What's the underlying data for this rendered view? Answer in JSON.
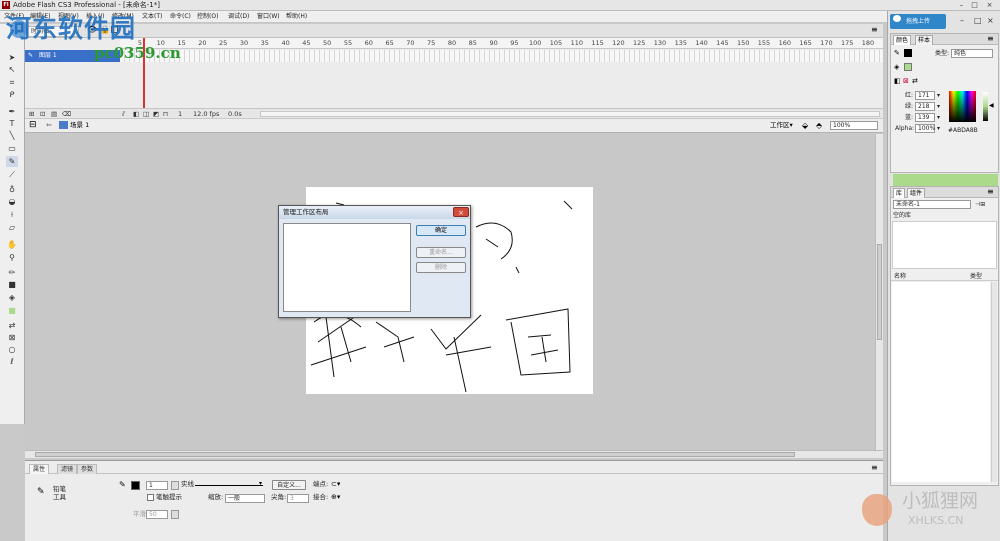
{
  "window": {
    "title": "Adobe Flash CS3 Professional - [未命名-1*]",
    "app_icon": "Fl",
    "min": "–",
    "max": "□",
    "close": "×"
  },
  "menu": [
    "文件(F)",
    "编辑(E)",
    "视图(V)",
    "插入(I)",
    "修改(M)",
    "文本(T)",
    "命令(C)",
    "控制(O)",
    "调试(D)",
    "窗口(W)",
    "帮助(H)"
  ],
  "watermark": {
    "site_name": "河东软件园",
    "site_url": "pc0359.cn",
    "bottom_name": "小狐狸网",
    "bottom_url": "XHLKS.CN"
  },
  "timeline": {
    "tab_label": "时间轴",
    "layer_name": "图层 1",
    "ruler_numbers": [
      "5",
      "10",
      "15",
      "20",
      "25",
      "30",
      "35",
      "40",
      "45",
      "50",
      "55",
      "60",
      "65",
      "70",
      "75",
      "80",
      "85",
      "90",
      "95",
      "100",
      "105",
      "110",
      "115",
      "120",
      "125",
      "130",
      "135",
      "140",
      "145",
      "150",
      "155",
      "160",
      "165",
      "170",
      "175",
      "180"
    ],
    "current_frame": "1",
    "fps": "12.0 fps",
    "elapsed": "0.0s"
  },
  "scene": {
    "back_arrow": "⇐",
    "scene_name": "场景 1",
    "workspace_label": "工作区▾",
    "zoom": "100%"
  },
  "dialog": {
    "title": "管理工作区布局",
    "close": "×",
    "ok": "确定",
    "rename": "重命名...",
    "delete": "删除"
  },
  "properties": {
    "tabs": [
      "属性",
      "滤镜",
      "参数"
    ],
    "tool_name_line1": "铅笔",
    "tool_name_line2": "工具",
    "stroke_size": "1",
    "stroke_style": "实线",
    "custom_button": "自定义...",
    "cap_label": "端点:",
    "stroke_hint_label": "笔触提示",
    "scale_label": "缩放:",
    "scale_value": "一般",
    "miter_label": "尖角:",
    "miter_value": "3",
    "join_label": "接合:",
    "smoothing_label": "平滑",
    "smoothing_value": "50"
  },
  "right_dock": {
    "share_label": "拖拽上传",
    "color_tabs": [
      "颜色",
      "样本"
    ],
    "type_label": "类型:",
    "type_value": "纯色",
    "red_label": "红:",
    "red_value": "171",
    "green_label": "绿:",
    "green_value": "218",
    "blue_label": "蓝:",
    "blue_value": "139",
    "alpha_label": "Alpha:",
    "alpha_value": "100%",
    "hex_value": "#ABDA8B",
    "preview_color": "#abda8b",
    "library_tabs": [
      "库",
      "组件"
    ],
    "library_doc": "未命名-1",
    "library_status": "空的库",
    "col_name": "名称",
    "col_type": "类型"
  },
  "colors": {
    "accent": "#2f86c9",
    "stage": "#ffffff",
    "stage_bg": "#c8c8c8",
    "playhead": "#e03030",
    "selection": "#3a6fc9"
  }
}
